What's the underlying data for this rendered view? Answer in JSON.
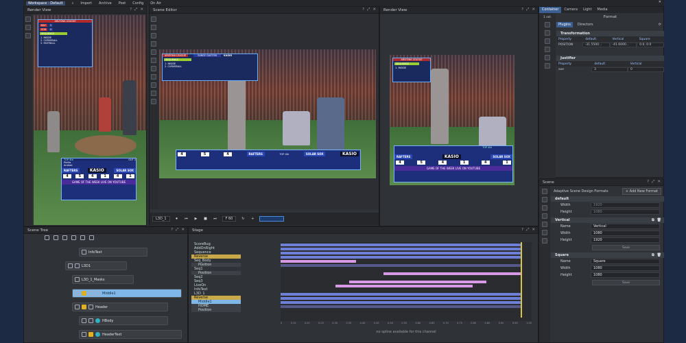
{
  "menu": {
    "workspace": "Workspace - Default",
    "import": "Import",
    "archive": "Archive",
    "post": "Post",
    "config": "Config",
    "onair": "On Air"
  },
  "render_view_left": {
    "title": "Render View"
  },
  "scene_editor": {
    "title": "Scene Editor",
    "node": "L3D_1",
    "frame": "F 60"
  },
  "render_view_right": {
    "title": "Render View"
  },
  "overlay": {
    "league": "ARIZONA LEAGUE",
    "away_abbr": "RAF",
    "home_abbr": "SOX",
    "away_runs": "3",
    "home_runs": "0",
    "lineup": [
      "SEQUENCE",
      "1. INSIDE",
      "2. CURVEBALL",
      "3. FASTBALL"
    ],
    "player_name": "SANDY GASTON",
    "brand": "KASIO",
    "away_team": "RAFTERS",
    "away_city": "SALT RIVER",
    "home_team": "SOLAR SOX",
    "home_city": "SALT RIVER",
    "inning": "TOP 4th",
    "count_label": "OUT 2",
    "inning_scores": [
      "4",
      "5",
      "4",
      "1",
      "4",
      "1"
    ],
    "stats": [
      {
        "name": "Pinilla",
        "val": "2/4"
      },
      {
        "name": "Andrae",
        "val": "1/3"
      },
      {
        "name": "Ayan",
        "val": "0/2"
      }
    ],
    "footer": "GAME OF THE WEEK LIVE ON YOUTUBE"
  },
  "scene_tree": {
    "title": "Scene Tree",
    "rows": [
      {
        "label": "InfoText"
      },
      {
        "label": "L3D1"
      },
      {
        "label": "L3D_1_Masks"
      },
      {
        "label": "Middle1"
      },
      {
        "label": "Header"
      },
      {
        "label": "HBody"
      },
      {
        "label": "HeaderText"
      }
    ]
  },
  "stage": {
    "title": "Stage",
    "items": [
      "ScoreBug",
      "AddOnRight",
      "Sequence",
      "Reverse",
      "Seq_Body",
      "Position",
      "Seq1",
      "Position",
      "Seq2",
      "Seq3",
      "LiveOn",
      "InfoText",
      "L3D_1",
      "Reverse",
      "Middle1",
      "HOME",
      "Position"
    ],
    "ruler": [
      "0",
      "0.15",
      "0.20",
      "0.25",
      "0.30",
      "0.35",
      "0.40",
      "0.45",
      "0.50",
      "0.55",
      "0.60",
      "0.65",
      "0.70",
      "0.75",
      "0.80",
      "0.85",
      "0.90",
      "0.95",
      "1.00"
    ],
    "status": "no spline available for this channel"
  },
  "right_panel": {
    "tabs": [
      "Container",
      "Camera",
      "Light",
      "Media"
    ],
    "sel": "1 sel.",
    "format_title": "Format",
    "subtabs": [
      "Plugins",
      "Directors"
    ],
    "transformation": {
      "title": "Transformation",
      "headers": [
        "Property",
        "default",
        "Vertical",
        "Square"
      ],
      "row": [
        "POSITION",
        "-31.5500...",
        "-41.6000...",
        "0.0, 0.0"
      ]
    },
    "justifier": {
      "title": "Justifier",
      "headers": [
        "Property",
        "default",
        "Vertical"
      ],
      "row": [
        "axe",
        "3",
        "0"
      ]
    }
  },
  "scene_panel": {
    "title": "Scene",
    "adaptive": "Adaptive Scene Design Formats",
    "add_button": "+ Add New Format",
    "default": {
      "title": "default",
      "width_label": "Width",
      "width": "1920",
      "height_label": "Height",
      "height": "1080"
    },
    "vertical": {
      "title": "Vertical",
      "name_label": "Name",
      "name": "Vertical",
      "width_label": "Width",
      "width": "1080",
      "height_label": "Height",
      "height": "1920",
      "save": "Save"
    },
    "square": {
      "title": "Square",
      "name_label": "Name",
      "name": "Square",
      "width_label": "Width",
      "width": "1080",
      "height_label": "Height",
      "height": "1080",
      "save": "Save"
    }
  }
}
